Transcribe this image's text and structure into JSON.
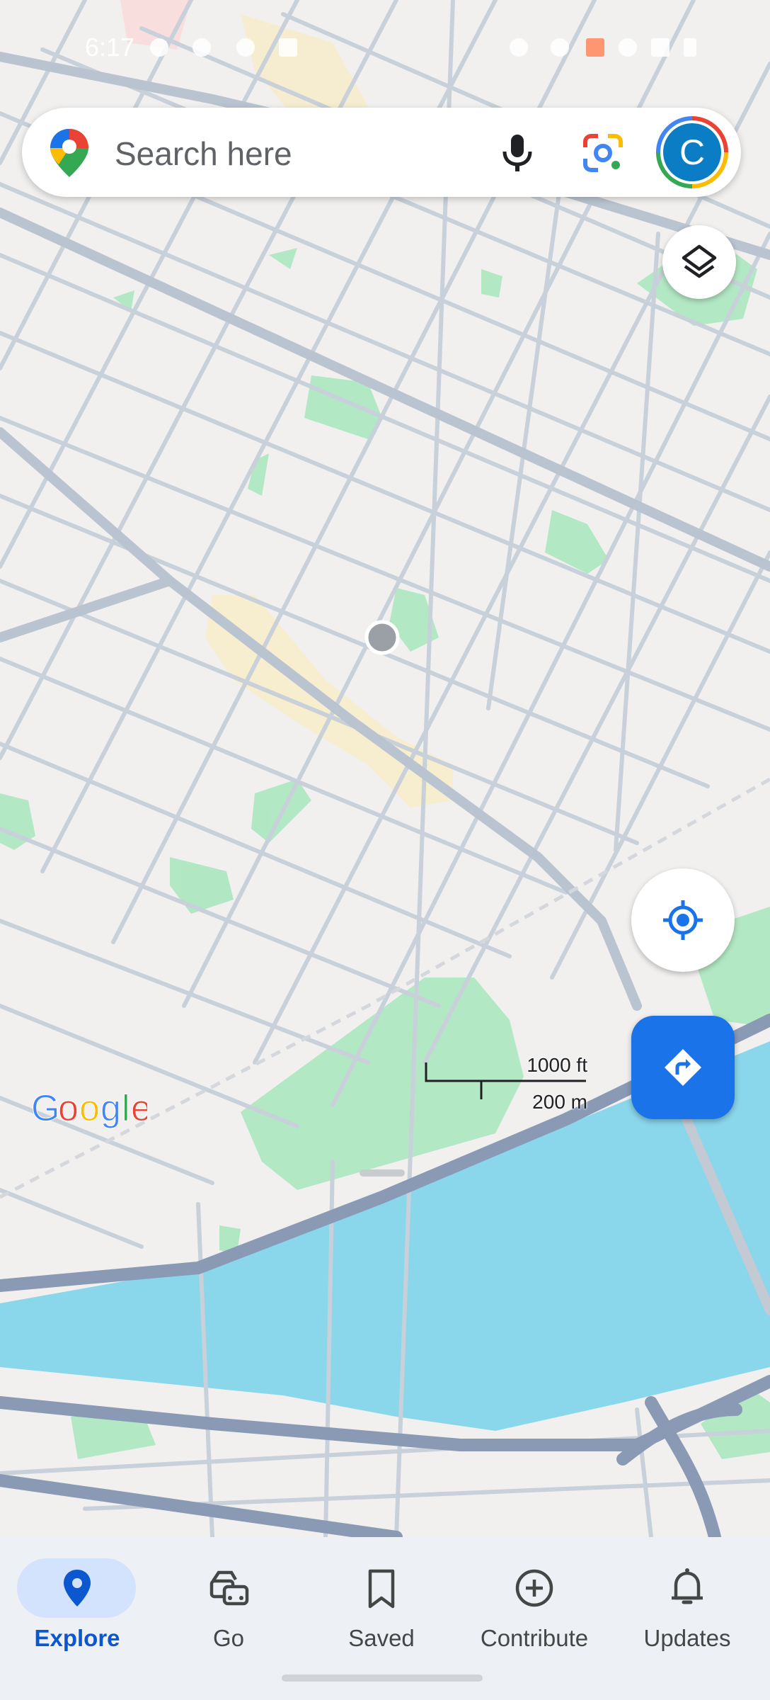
{
  "status_bar": {
    "time": "6:17"
  },
  "search": {
    "placeholder": "Search here",
    "avatar_letter": "C",
    "icons": [
      "maps-pin-icon",
      "microphone-icon",
      "google-lens-icon"
    ]
  },
  "map": {
    "provider_logo": "Google",
    "scale": {
      "imperial": "1000 ft",
      "metric": "200 m"
    },
    "colors": {
      "land": "#f1f0ef",
      "road": "#c8d0d9",
      "highway": "#8a9ab5",
      "park": "#a8e6bd",
      "water": "#8ad6eb",
      "commercial": "#f8ecc9"
    }
  },
  "controls": {
    "layers": "layers-icon",
    "my_location": "my-location-icon",
    "directions": "directions-icon"
  },
  "nav": {
    "items": [
      {
        "label": "Explore",
        "icon": "explore-pin-icon",
        "active": true
      },
      {
        "label": "Go",
        "icon": "go-car-icon",
        "active": false
      },
      {
        "label": "Saved",
        "icon": "bookmark-icon",
        "active": false
      },
      {
        "label": "Contribute",
        "icon": "add-circle-icon",
        "active": false
      },
      {
        "label": "Updates",
        "icon": "bell-icon",
        "active": false
      }
    ]
  }
}
